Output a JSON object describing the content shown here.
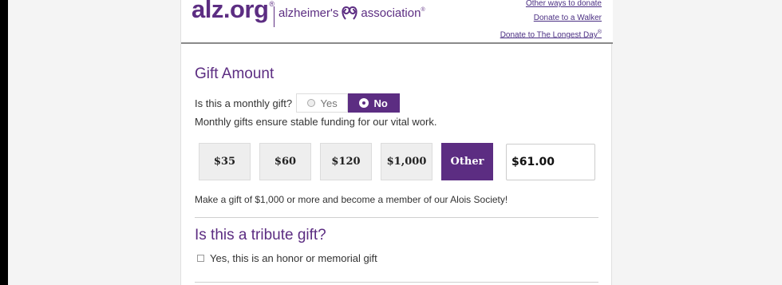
{
  "header": {
    "logo_text": "alz.org",
    "logo_reg": "®",
    "logo_sub_left": "alzheimer's",
    "logo_sub_right": "association",
    "logo_sub_reg": "®",
    "links": [
      "Other ways to donate",
      "Donate to a Walker",
      "Donate to The Longest Day"
    ],
    "links_sup": "®"
  },
  "gift_amount": {
    "title": "Gift Amount",
    "monthly_question": "Is this a monthly gift?",
    "yes_label": "Yes",
    "no_label": "No",
    "monthly_selected": "No",
    "monthly_note": "Monthly gifts ensure stable funding for our vital work.",
    "amounts": [
      "$35",
      "$60",
      "$120",
      "$1,000",
      "Other"
    ],
    "selected_amount": "Other",
    "other_value": "$61.00",
    "society_note": "Make a gift of $1,000 or more and become a member of our Alois Society!"
  },
  "tribute": {
    "title": "Is this a tribute gift?",
    "checkbox_label": "Yes, this is an honor or memorial gift",
    "checked": false
  },
  "colors": {
    "brand": "#5c2d82",
    "link": "#4b2f83"
  }
}
